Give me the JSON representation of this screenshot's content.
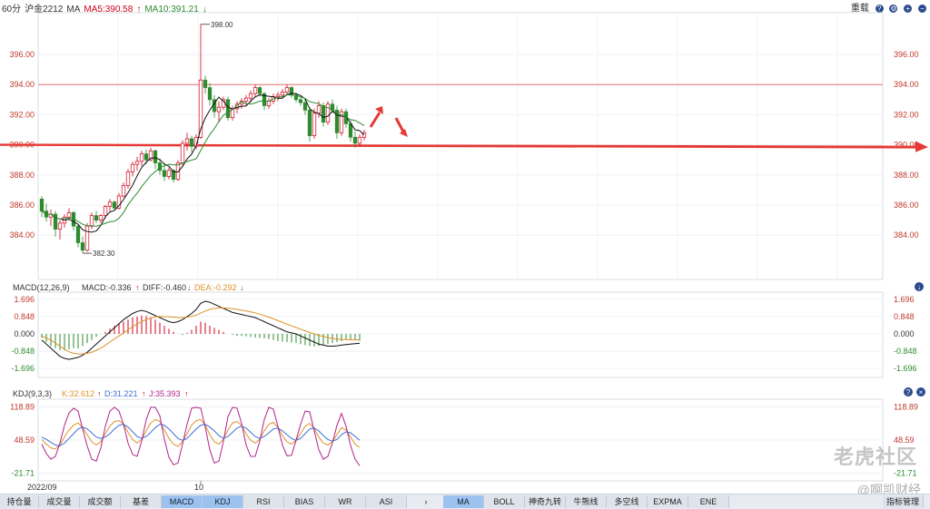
{
  "topbar": {
    "period": "60分",
    "symbol": "沪金2212",
    "indicator": "MA",
    "ma5": "MA5:390.58",
    "ma10": "MA10:391.21",
    "right_label": "重载"
  },
  "main_chart": {
    "y_ticks": [
      "396.00",
      "394.00",
      "392.00",
      "390.00",
      "388.00",
      "386.00",
      "384.00"
    ],
    "high_label": "398.00",
    "low_label": "382.30",
    "resistance": 394.0,
    "support": 390.0,
    "up_arrow": true,
    "down_arrow": true
  },
  "macd_panel": {
    "title": "MACD(12,26,9)",
    "macd": "MACD:-0.336",
    "diff": "DIFF:-0.460",
    "dea": "DEA:-0.292",
    "y_ticks": [
      "1.696",
      "0.848",
      "0.000",
      "-0.848",
      "-1.696"
    ]
  },
  "kdj_panel": {
    "title": "KDJ(9,3,3)",
    "k": "K:32.612",
    "d": "D:31.221",
    "j": "J:35.393",
    "y_ticks": [
      "118.89",
      "48.59",
      "-21.71"
    ]
  },
  "x_axis": {
    "labels": [
      "2022/09",
      "10"
    ]
  },
  "bottom_tabs_left": [
    "持仓量",
    "成交量",
    "成交额",
    "基差",
    "MACD",
    "KDJ",
    "RSI",
    "BIAS",
    "WR",
    "ASI"
  ],
  "bottom_tabs_right": [
    "MA",
    "BOLL",
    "神奇九转",
    "牛熊线",
    "多空线",
    "EXPMA",
    "ENE",
    "指标管理"
  ],
  "colors": {
    "up": "#d0021b",
    "down": "#2e8b2e",
    "line_red": "#e53935",
    "ma5": "#111111",
    "ma10": "#e0902a",
    "k": "#e0902a",
    "d": "#3b6fd8",
    "j": "#b0238c",
    "axis_text": "#c0392b"
  },
  "watermark": "老虎社区",
  "watermark_sub": "@啊凯财经",
  "chart_data": {
    "type": "candlestick",
    "title": "沪金2212 60分",
    "ylim": [
      382.3,
      398.0
    ],
    "x_labels": [
      "2022/09",
      "10"
    ],
    "ohlc": [
      [
        386.4,
        386.6,
        385.2,
        385.6
      ],
      [
        385.6,
        386.1,
        384.9,
        385.2
      ],
      [
        385.2,
        385.7,
        384.6,
        385.4
      ],
      [
        385.4,
        385.6,
        383.9,
        384.4
      ],
      [
        384.4,
        385.0,
        383.7,
        384.8
      ],
      [
        384.8,
        385.4,
        384.5,
        385.2
      ],
      [
        385.2,
        385.8,
        385.0,
        385.5
      ],
      [
        385.5,
        385.6,
        384.3,
        384.6
      ],
      [
        384.6,
        384.7,
        383.2,
        383.5
      ],
      [
        383.5,
        383.9,
        382.8,
        383.0
      ],
      [
        383.0,
        384.8,
        382.9,
        384.6
      ],
      [
        384.6,
        385.5,
        384.4,
        385.3
      ],
      [
        385.3,
        385.6,
        384.8,
        385.0
      ],
      [
        385.0,
        385.4,
        384.8,
        385.3
      ],
      [
        385.3,
        386.0,
        385.1,
        385.9
      ],
      [
        385.9,
        386.4,
        385.6,
        386.2
      ],
      [
        386.2,
        386.3,
        385.7,
        385.8
      ],
      [
        385.8,
        386.8,
        385.7,
        386.6
      ],
      [
        386.6,
        387.5,
        386.5,
        387.3
      ],
      [
        387.3,
        388.4,
        387.1,
        388.2
      ],
      [
        388.2,
        388.9,
        387.9,
        388.7
      ],
      [
        388.7,
        389.2,
        388.3,
        388.9
      ],
      [
        388.9,
        389.6,
        388.6,
        389.4
      ],
      [
        389.4,
        389.7,
        388.7,
        389.0
      ],
      [
        389.0,
        389.8,
        388.9,
        389.6
      ],
      [
        389.6,
        389.7,
        388.4,
        388.8
      ],
      [
        388.8,
        389.1,
        388.0,
        388.3
      ],
      [
        388.3,
        388.8,
        387.6,
        387.9
      ],
      [
        387.9,
        388.5,
        387.7,
        388.3
      ],
      [
        388.3,
        388.4,
        387.5,
        387.7
      ],
      [
        387.7,
        389.0,
        387.6,
        388.8
      ],
      [
        388.8,
        390.3,
        388.6,
        390.1
      ],
      [
        390.1,
        390.8,
        389.6,
        390.4
      ],
      [
        390.4,
        390.6,
        389.5,
        389.9
      ],
      [
        389.9,
        390.7,
        389.7,
        390.5
      ],
      [
        390.5,
        398.0,
        390.4,
        394.3
      ],
      [
        394.3,
        394.6,
        393.4,
        393.8
      ],
      [
        393.8,
        394.1,
        392.6,
        393.0
      ],
      [
        393.0,
        393.3,
        391.8,
        392.2
      ],
      [
        392.2,
        392.9,
        391.5,
        392.5
      ],
      [
        392.5,
        393.2,
        392.3,
        393.0
      ],
      [
        393.0,
        393.2,
        391.6,
        391.8
      ],
      [
        391.8,
        392.6,
        391.6,
        392.4
      ],
      [
        392.4,
        392.9,
        392.1,
        392.7
      ],
      [
        392.7,
        393.1,
        392.4,
        392.9
      ],
      [
        392.9,
        393.3,
        392.6,
        393.1
      ],
      [
        393.1,
        393.6,
        392.8,
        393.4
      ],
      [
        393.4,
        394.0,
        393.2,
        393.8
      ],
      [
        393.8,
        393.9,
        393.2,
        393.4
      ],
      [
        393.4,
        393.5,
        392.3,
        392.6
      ],
      [
        392.6,
        393.1,
        392.4,
        392.9
      ],
      [
        392.9,
        393.4,
        392.7,
        393.2
      ],
      [
        393.2,
        393.5,
        392.9,
        393.3
      ],
      [
        393.3,
        393.7,
        393.1,
        393.5
      ],
      [
        393.5,
        394.0,
        393.3,
        393.8
      ],
      [
        393.8,
        393.9,
        393.1,
        393.3
      ],
      [
        393.3,
        393.5,
        392.8,
        393.0
      ],
      [
        393.0,
        393.2,
        392.6,
        392.8
      ],
      [
        392.8,
        393.1,
        392.0,
        392.3
      ],
      [
        392.3,
        392.5,
        390.2,
        390.6
      ],
      [
        390.6,
        392.4,
        390.4,
        392.1
      ],
      [
        392.1,
        392.9,
        391.8,
        392.6
      ],
      [
        392.6,
        392.8,
        391.2,
        391.5
      ],
      [
        391.5,
        392.9,
        391.3,
        392.7
      ],
      [
        392.7,
        393.0,
        392.1,
        392.3
      ],
      [
        392.3,
        392.6,
        390.4,
        390.8
      ],
      [
        390.8,
        392.4,
        390.6,
        392.2
      ],
      [
        392.2,
        392.4,
        391.1,
        391.4
      ],
      [
        391.4,
        391.6,
        390.2,
        390.5
      ],
      [
        390.5,
        390.9,
        389.8,
        390.1
      ],
      [
        390.1,
        390.7,
        389.9,
        390.5
      ],
      [
        390.5,
        391.0,
        390.3,
        390.8
      ]
    ],
    "macd": {
      "hist": [
        -0.2,
        -0.4,
        -0.6,
        -0.7,
        -0.8,
        -0.8,
        -0.75,
        -0.7,
        -0.72,
        -0.6,
        -0.45,
        -0.3,
        -0.15,
        0.0,
        0.1,
        0.25,
        0.4,
        0.5,
        0.6,
        0.7,
        0.8,
        0.85,
        0.9,
        0.88,
        0.8,
        0.7,
        0.55,
        0.4,
        0.25,
        0.1,
        0.0,
        -0.05,
        0.05,
        0.2,
        0.4,
        0.6,
        0.55,
        0.4,
        0.3,
        0.2,
        0.1,
        0.0,
        -0.05,
        -0.1,
        -0.1,
        -0.12,
        -0.15,
        -0.18,
        -0.2,
        -0.22,
        -0.25,
        -0.3,
        -0.35,
        -0.38,
        -0.4,
        -0.42,
        -0.45,
        -0.5,
        -0.55,
        -0.6,
        -0.62,
        -0.6,
        -0.55,
        -0.5,
        -0.45,
        -0.4,
        -0.35,
        -0.3,
        -0.28,
        -0.3,
        -0.34
      ],
      "diff": [
        -0.3,
        -0.5,
        -0.7,
        -0.9,
        -1.1,
        -1.2,
        -1.25,
        -1.2,
        -1.15,
        -1.05,
        -0.9,
        -0.7,
        -0.5,
        -0.3,
        -0.1,
        0.1,
        0.3,
        0.5,
        0.7,
        0.85,
        1.0,
        1.1,
        1.15,
        1.1,
        1.0,
        0.9,
        0.8,
        0.7,
        0.6,
        0.55,
        0.6,
        0.7,
        0.85,
        1.0,
        1.2,
        1.5,
        1.6,
        1.55,
        1.45,
        1.35,
        1.25,
        1.15,
        1.05,
        1.0,
        0.95,
        0.9,
        0.85,
        0.8,
        0.7,
        0.6,
        0.5,
        0.4,
        0.3,
        0.2,
        0.1,
        0.05,
        0.0,
        -0.1,
        -0.2,
        -0.3,
        -0.4,
        -0.5,
        -0.55,
        -0.6,
        -0.6,
        -0.58,
        -0.55,
        -0.52,
        -0.5,
        -0.48,
        -0.46
      ],
      "dea": [
        -0.1,
        -0.2,
        -0.3,
        -0.45,
        -0.6,
        -0.75,
        -0.88,
        -0.95,
        -0.98,
        -0.98,
        -0.95,
        -0.9,
        -0.8,
        -0.7,
        -0.55,
        -0.4,
        -0.25,
        -0.1,
        0.05,
        0.2,
        0.35,
        0.48,
        0.6,
        0.7,
        0.78,
        0.83,
        0.85,
        0.85,
        0.84,
        0.82,
        0.8,
        0.8,
        0.82,
        0.86,
        0.92,
        1.02,
        1.12,
        1.2,
        1.25,
        1.27,
        1.27,
        1.26,
        1.23,
        1.2,
        1.16,
        1.12,
        1.08,
        1.03,
        0.97,
        0.9,
        0.82,
        0.74,
        0.65,
        0.56,
        0.47,
        0.39,
        0.31,
        0.23,
        0.15,
        0.07,
        0.0,
        -0.07,
        -0.13,
        -0.18,
        -0.22,
        -0.25,
        -0.27,
        -0.28,
        -0.29,
        -0.29,
        -0.29
      ]
    },
    "kdj": {
      "k": [
        50,
        40,
        32,
        30,
        38,
        55,
        70,
        80,
        85,
        75,
        60,
        45,
        38,
        45,
        62,
        78,
        88,
        90,
        82,
        65,
        50,
        42,
        50,
        68,
        85,
        92,
        88,
        70,
        52,
        40,
        35,
        45,
        62,
        80,
        90,
        92,
        80,
        60,
        45,
        40,
        50,
        70,
        85,
        88,
        80,
        62,
        48,
        42,
        50,
        68,
        82,
        86,
        75,
        58,
        45,
        40,
        48,
        62,
        78,
        84,
        72,
        55,
        42,
        38,
        45,
        60,
        75,
        70,
        55,
        40,
        33
      ],
      "d": [
        55,
        50,
        44,
        38,
        36,
        42,
        52,
        62,
        72,
        76,
        72,
        64,
        55,
        52,
        55,
        62,
        72,
        80,
        82,
        76,
        66,
        56,
        52,
        56,
        65,
        75,
        82,
        80,
        72,
        62,
        52,
        48,
        52,
        62,
        72,
        80,
        82,
        76,
        68,
        58,
        52,
        56,
        65,
        74,
        78,
        74,
        65,
        56,
        52,
        56,
        64,
        72,
        74,
        68,
        60,
        52,
        48,
        52,
        62,
        72,
        74,
        68,
        58,
        50,
        46,
        50,
        60,
        66,
        64,
        56,
        48
      ],
      "j": [
        40,
        20,
        8,
        14,
        42,
        80,
        106,
        116,
        110,
        72,
        36,
        8,
        4,
        32,
        78,
        110,
        118,
        110,
        82,
        42,
        18,
        14,
        46,
        92,
        118,
        118,
        100,
        50,
        12,
        -4,
        0,
        40,
        82,
        116,
        118,
        116,
        76,
        28,
        0,
        4,
        46,
        98,
        118,
        116,
        84,
        38,
        14,
        14,
        46,
        92,
        118,
        114,
        77,
        38,
        15,
        16,
        48,
        82,
        110,
        108,
        68,
        28,
        8,
        14,
        42,
        80,
        105,
        78,
        37,
        8,
        -6
      ]
    }
  }
}
